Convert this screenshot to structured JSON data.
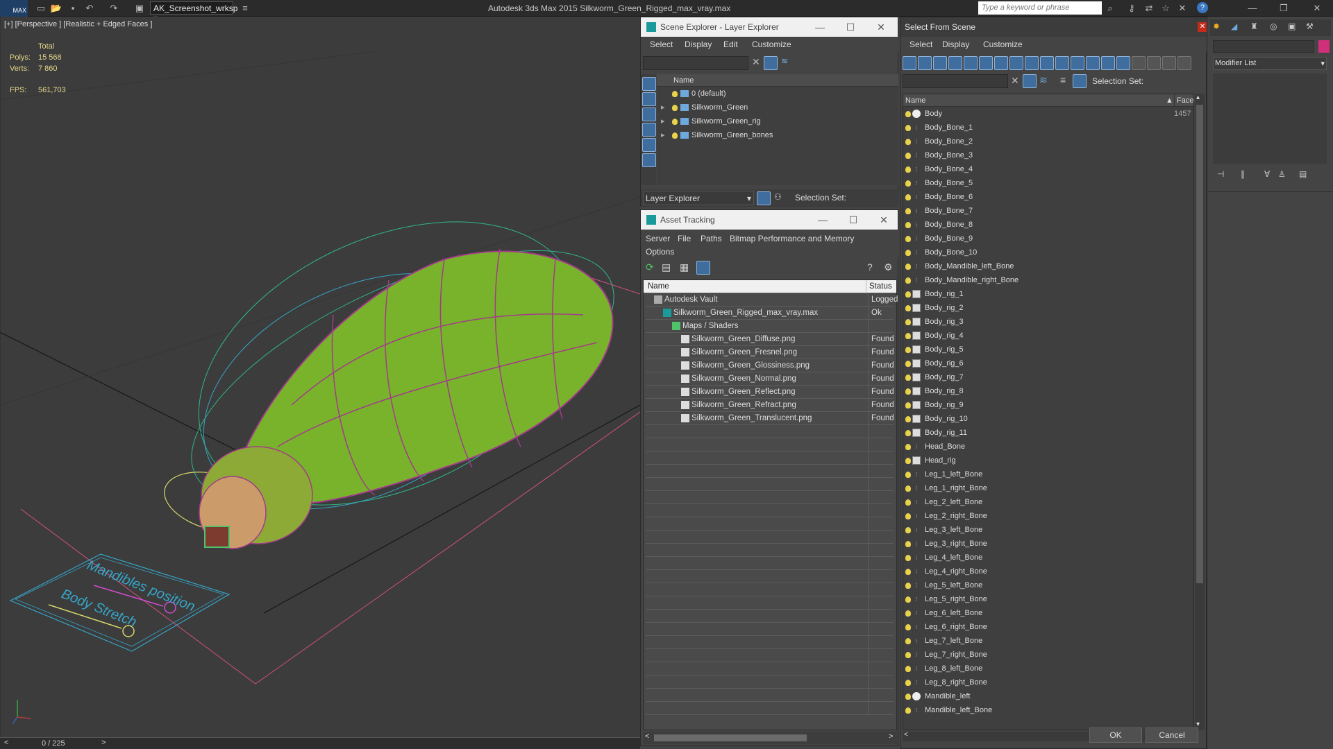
{
  "titlebar": {
    "logo": "MAX",
    "workspace": "AK_Screenshot_wrksp",
    "app_title": "Autodesk 3ds Max  2015     Silkworm_Green_Rigged_max_vray.max",
    "search_placeholder": "Type a keyword or phrase",
    "icons": [
      "new-icon",
      "open-icon",
      "save-icon",
      "undo-icon",
      "redo-icon",
      "binoculars-icon",
      "key-icon",
      "exchange-icon",
      "star-icon",
      "close-x-icon",
      "help-icon",
      "minimize-icon",
      "restore-icon",
      "close-icon"
    ]
  },
  "viewport": {
    "label": "[+] [Perspective ] [Realistic + Edged Faces ]",
    "stats_header": "Total",
    "polys_label": "Polys:",
    "polys_value": "15 568",
    "verts_label": "Verts:",
    "verts_value": "7 860",
    "fps_label": "FPS:",
    "fps_value": "561,703",
    "rig_text_1": "Mandibles position",
    "rig_text_2": "Body Stretch",
    "frame_counter": "0 / 225"
  },
  "scene_explorer": {
    "title": "Scene Explorer - Layer Explorer",
    "menus": [
      "Select",
      "Display",
      "Edit",
      "Customize"
    ],
    "column_name": "Name",
    "layers": [
      {
        "name": "0 (default)",
        "expandable": false
      },
      {
        "name": "Silkworm_Green",
        "expandable": true
      },
      {
        "name": "Silkworm_Green_rig",
        "expandable": true
      },
      {
        "name": "Silkworm_Green_bones",
        "expandable": true
      }
    ],
    "footer_dropdown": "Layer Explorer",
    "selection_set_label": "Selection Set:"
  },
  "asset_tracking": {
    "title": "Asset Tracking",
    "menus": [
      "Server",
      "File",
      "Paths",
      "Bitmap Performance and Memory"
    ],
    "menu_options": "Options",
    "col_name": "Name",
    "col_status": "Status",
    "rows": [
      {
        "name": "Autodesk Vault",
        "status": "Logged",
        "indent": 0,
        "icon": "vault"
      },
      {
        "name": "Silkworm_Green_Rigged_max_vray.max",
        "status": "Ok",
        "indent": 1,
        "icon": "max"
      },
      {
        "name": "Maps / Shaders",
        "status": "",
        "indent": 2,
        "icon": "folder"
      },
      {
        "name": "Silkworm_Green_Diffuse.png",
        "status": "Found",
        "indent": 3,
        "icon": "file"
      },
      {
        "name": "Silkworm_Green_Fresnel.png",
        "status": "Found",
        "indent": 3,
        "icon": "file"
      },
      {
        "name": "Silkworm_Green_Glossiness.png",
        "status": "Found",
        "indent": 3,
        "icon": "file"
      },
      {
        "name": "Silkworm_Green_Normal.png",
        "status": "Found",
        "indent": 3,
        "icon": "file"
      },
      {
        "name": "Silkworm_Green_Reflect.png",
        "status": "Found",
        "indent": 3,
        "icon": "file"
      },
      {
        "name": "Silkworm_Green_Refract.png",
        "status": "Found",
        "indent": 3,
        "icon": "file"
      },
      {
        "name": "Silkworm_Green_Translucent.png",
        "status": "Found",
        "indent": 3,
        "icon": "file"
      }
    ]
  },
  "select_from_scene": {
    "title": "Select From Scene",
    "menus": [
      "Select",
      "Display",
      "Customize"
    ],
    "selection_set_label": "Selection Set:",
    "col_name": "Name",
    "col_faces": "Faces",
    "first_faces_value": "1457",
    "items": [
      {
        "name": "Body",
        "type": "mesh"
      },
      {
        "name": "Body_Bone_1",
        "type": "bone"
      },
      {
        "name": "Body_Bone_2",
        "type": "bone"
      },
      {
        "name": "Body_Bone_3",
        "type": "bone"
      },
      {
        "name": "Body_Bone_4",
        "type": "bone"
      },
      {
        "name": "Body_Bone_5",
        "type": "bone"
      },
      {
        "name": "Body_Bone_6",
        "type": "bone"
      },
      {
        "name": "Body_Bone_7",
        "type": "bone"
      },
      {
        "name": "Body_Bone_8",
        "type": "bone"
      },
      {
        "name": "Body_Bone_9",
        "type": "bone"
      },
      {
        "name": "Body_Bone_10",
        "type": "bone"
      },
      {
        "name": "Body_Mandible_left_Bone",
        "type": "bone"
      },
      {
        "name": "Body_Mandible_right_Bone",
        "type": "bone"
      },
      {
        "name": "Body_rig_1",
        "type": "rig"
      },
      {
        "name": "Body_rig_2",
        "type": "rig"
      },
      {
        "name": "Body_rig_3",
        "type": "rig"
      },
      {
        "name": "Body_rig_4",
        "type": "rig"
      },
      {
        "name": "Body_rig_5",
        "type": "rig"
      },
      {
        "name": "Body_rig_6",
        "type": "rig"
      },
      {
        "name": "Body_rig_7",
        "type": "rig"
      },
      {
        "name": "Body_rig_8",
        "type": "rig"
      },
      {
        "name": "Body_rig_9",
        "type": "rig"
      },
      {
        "name": "Body_rig_10",
        "type": "rig"
      },
      {
        "name": "Body_rig_11",
        "type": "rig"
      },
      {
        "name": "Head_Bone",
        "type": "bone"
      },
      {
        "name": "Head_rig",
        "type": "rig"
      },
      {
        "name": "Leg_1_left_Bone",
        "type": "bone"
      },
      {
        "name": "Leg_1_right_Bone",
        "type": "bone"
      },
      {
        "name": "Leg_2_left_Bone",
        "type": "bone"
      },
      {
        "name": "Leg_2_right_Bone",
        "type": "bone"
      },
      {
        "name": "Leg_3_left_Bone",
        "type": "bone"
      },
      {
        "name": "Leg_3_right_Bone",
        "type": "bone"
      },
      {
        "name": "Leg_4_left_Bone",
        "type": "bone"
      },
      {
        "name": "Leg_4_right_Bone",
        "type": "bone"
      },
      {
        "name": "Leg_5_left_Bone",
        "type": "bone"
      },
      {
        "name": "Leg_5_right_Bone",
        "type": "bone"
      },
      {
        "name": "Leg_6_left_Bone",
        "type": "bone"
      },
      {
        "name": "Leg_6_right_Bone",
        "type": "bone"
      },
      {
        "name": "Leg_7_left_Bone",
        "type": "bone"
      },
      {
        "name": "Leg_7_right_Bone",
        "type": "bone"
      },
      {
        "name": "Leg_8_left_Bone",
        "type": "bone"
      },
      {
        "name": "Leg_8_right_Bone",
        "type": "bone"
      },
      {
        "name": "Mandible_left",
        "type": "mesh"
      },
      {
        "name": "Mandible_left_Bone",
        "type": "bone"
      }
    ],
    "ok_label": "OK",
    "cancel_label": "Cancel"
  },
  "command_panel": {
    "modifier_list": "Modifier List"
  }
}
